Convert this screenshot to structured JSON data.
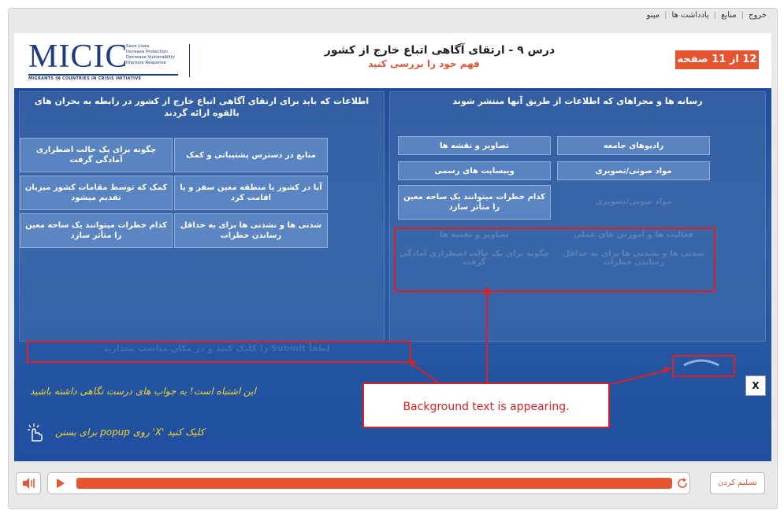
{
  "topnav": {
    "items": [
      "خروج",
      "منابع",
      "یادداشت ها",
      "مینو"
    ]
  },
  "logo": {
    "main": "MICIC",
    "tagline": [
      "Save Lives",
      "Increase Protection",
      "Decrease Vulnerability",
      "Improve Response"
    ],
    "subtitle": "MIGRANTS IN COUNTRIES IN CRISIS INITIATIVE"
  },
  "lesson": {
    "title": "درس ۹ - ارتقای آگاهی اتباع خارج از کشور",
    "subtitle": "فهم خود را بررسی کنید",
    "counter": "12 از 11 صفحه"
  },
  "left_panel": {
    "title": "اطلاعات که باید برای ارتقای آگاهی اتباع خارج از کشور در رابطه به بحران های بالقوه ارائه گردند",
    "cells": [
      "منابع در دسترس پشتیبانی و کمک",
      "چگونه برای یک حالت اضطراری آمادگی گرفت",
      "آیا در کشور یا منطقه معین سفر و یا اقامت کرد",
      "کمک که توسط مقامات کشور میزبان تقدیم میشود",
      "شدنی ها و نشدنی ها برای به حداقل رساندن خطرات",
      "کدام خطرات میتوانند یک ساحه معین را متأثر سازد"
    ]
  },
  "right_panel": {
    "title": "رسانه ها و مجراهای که اطلاعات از طریق آنها منتشر شوند",
    "cells": [
      "رادیوهای جامعه",
      "تصاویر و نقشه ها",
      "مواد صوتی/تصویری",
      "ویبسایت های رسمی",
      "کدام خطرات میتوانند یک ساحه معین را متأثر سازد"
    ],
    "ghost": [
      "فعالیت ها و آموزش های عملی",
      "تصاویر و نقشه ها",
      "شدنی ها و نشدنی ها برای به حداقل رساندن خطرات",
      "چگونه برای یک حالت اضطراری آمادگی گرفت",
      "مواد صوتی/تصویری"
    ]
  },
  "ghost_instruction": "لطفاً Submit را کلیک کنید و در مکان مناسب بیندازید",
  "callout": "Background text is appearing.",
  "feedback": "این اشتباه است! به جواب های درست نگاهی داشته باشید",
  "close_hint": "کلیک کنید 'X' روی popup برای بستن",
  "close_label": "X",
  "submit_label": "تسلیم کردن",
  "colors": {
    "accent": "#e8542f",
    "stage": "#1f4d9b",
    "highlight": "#e02020",
    "feedback": "#f2d42a"
  }
}
